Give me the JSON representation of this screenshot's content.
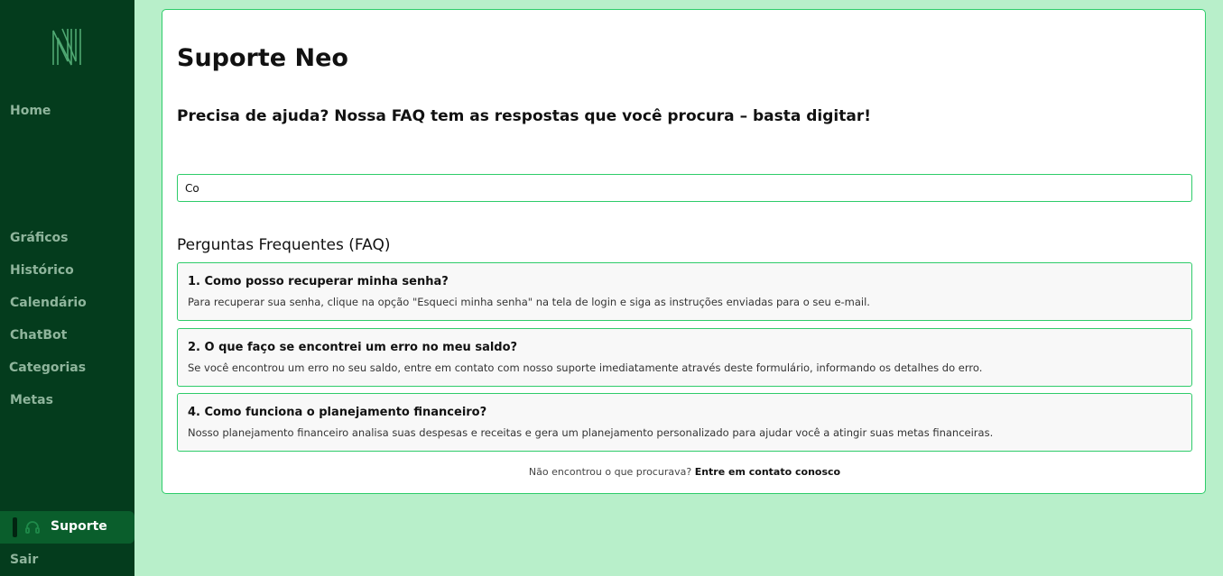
{
  "sidebar": {
    "logo_icon": "neo-logo-icon",
    "items": [
      {
        "label": "Home"
      },
      {
        "label": "Gráficos"
      },
      {
        "label": "Histórico"
      },
      {
        "label": "Calendário"
      },
      {
        "label": "ChatBot"
      },
      {
        "label": "Categorias"
      },
      {
        "label": "Metas"
      }
    ],
    "active": {
      "label": "Suporte",
      "icon": "headset-icon"
    },
    "logout": {
      "label": "Sair"
    }
  },
  "main": {
    "title": "Suporte Neo",
    "subtitle": "Precisa de ajuda? Nossa FAQ tem as respostas que você procura – basta digitar!",
    "search": {
      "value": "Co",
      "placeholder": ""
    },
    "faq_heading": "Perguntas Frequentes (FAQ)",
    "faq": [
      {
        "question": "1. Como posso recuperar minha senha?",
        "answer": "Para recuperar sua senha, clique na opção \"Esqueci minha senha\" na tela de login e siga as instruções enviadas para o seu e-mail."
      },
      {
        "question": "2. O que faço se encontrei um erro no meu saldo?",
        "answer": "Se você encontrou um erro no seu saldo, entre em contato com nosso suporte imediatamente através deste formulário, informando os detalhes do erro."
      },
      {
        "question": "4. Como funciona o planejamento financeiro?",
        "answer": "Nosso planejamento financeiro analisa suas despesas e receitas e gera um planejamento personalizado para ajudar você a atingir suas metas financeiras."
      }
    ],
    "footer": {
      "text": "Não encontrou o que procurava?",
      "link": "Entre em contato conosco"
    }
  },
  "colors": {
    "sidebar_bg": "#043c1d",
    "active_bg": "#0a5e2c",
    "page_bg": "#b8efca",
    "accent_border": "#2ecc6a"
  }
}
